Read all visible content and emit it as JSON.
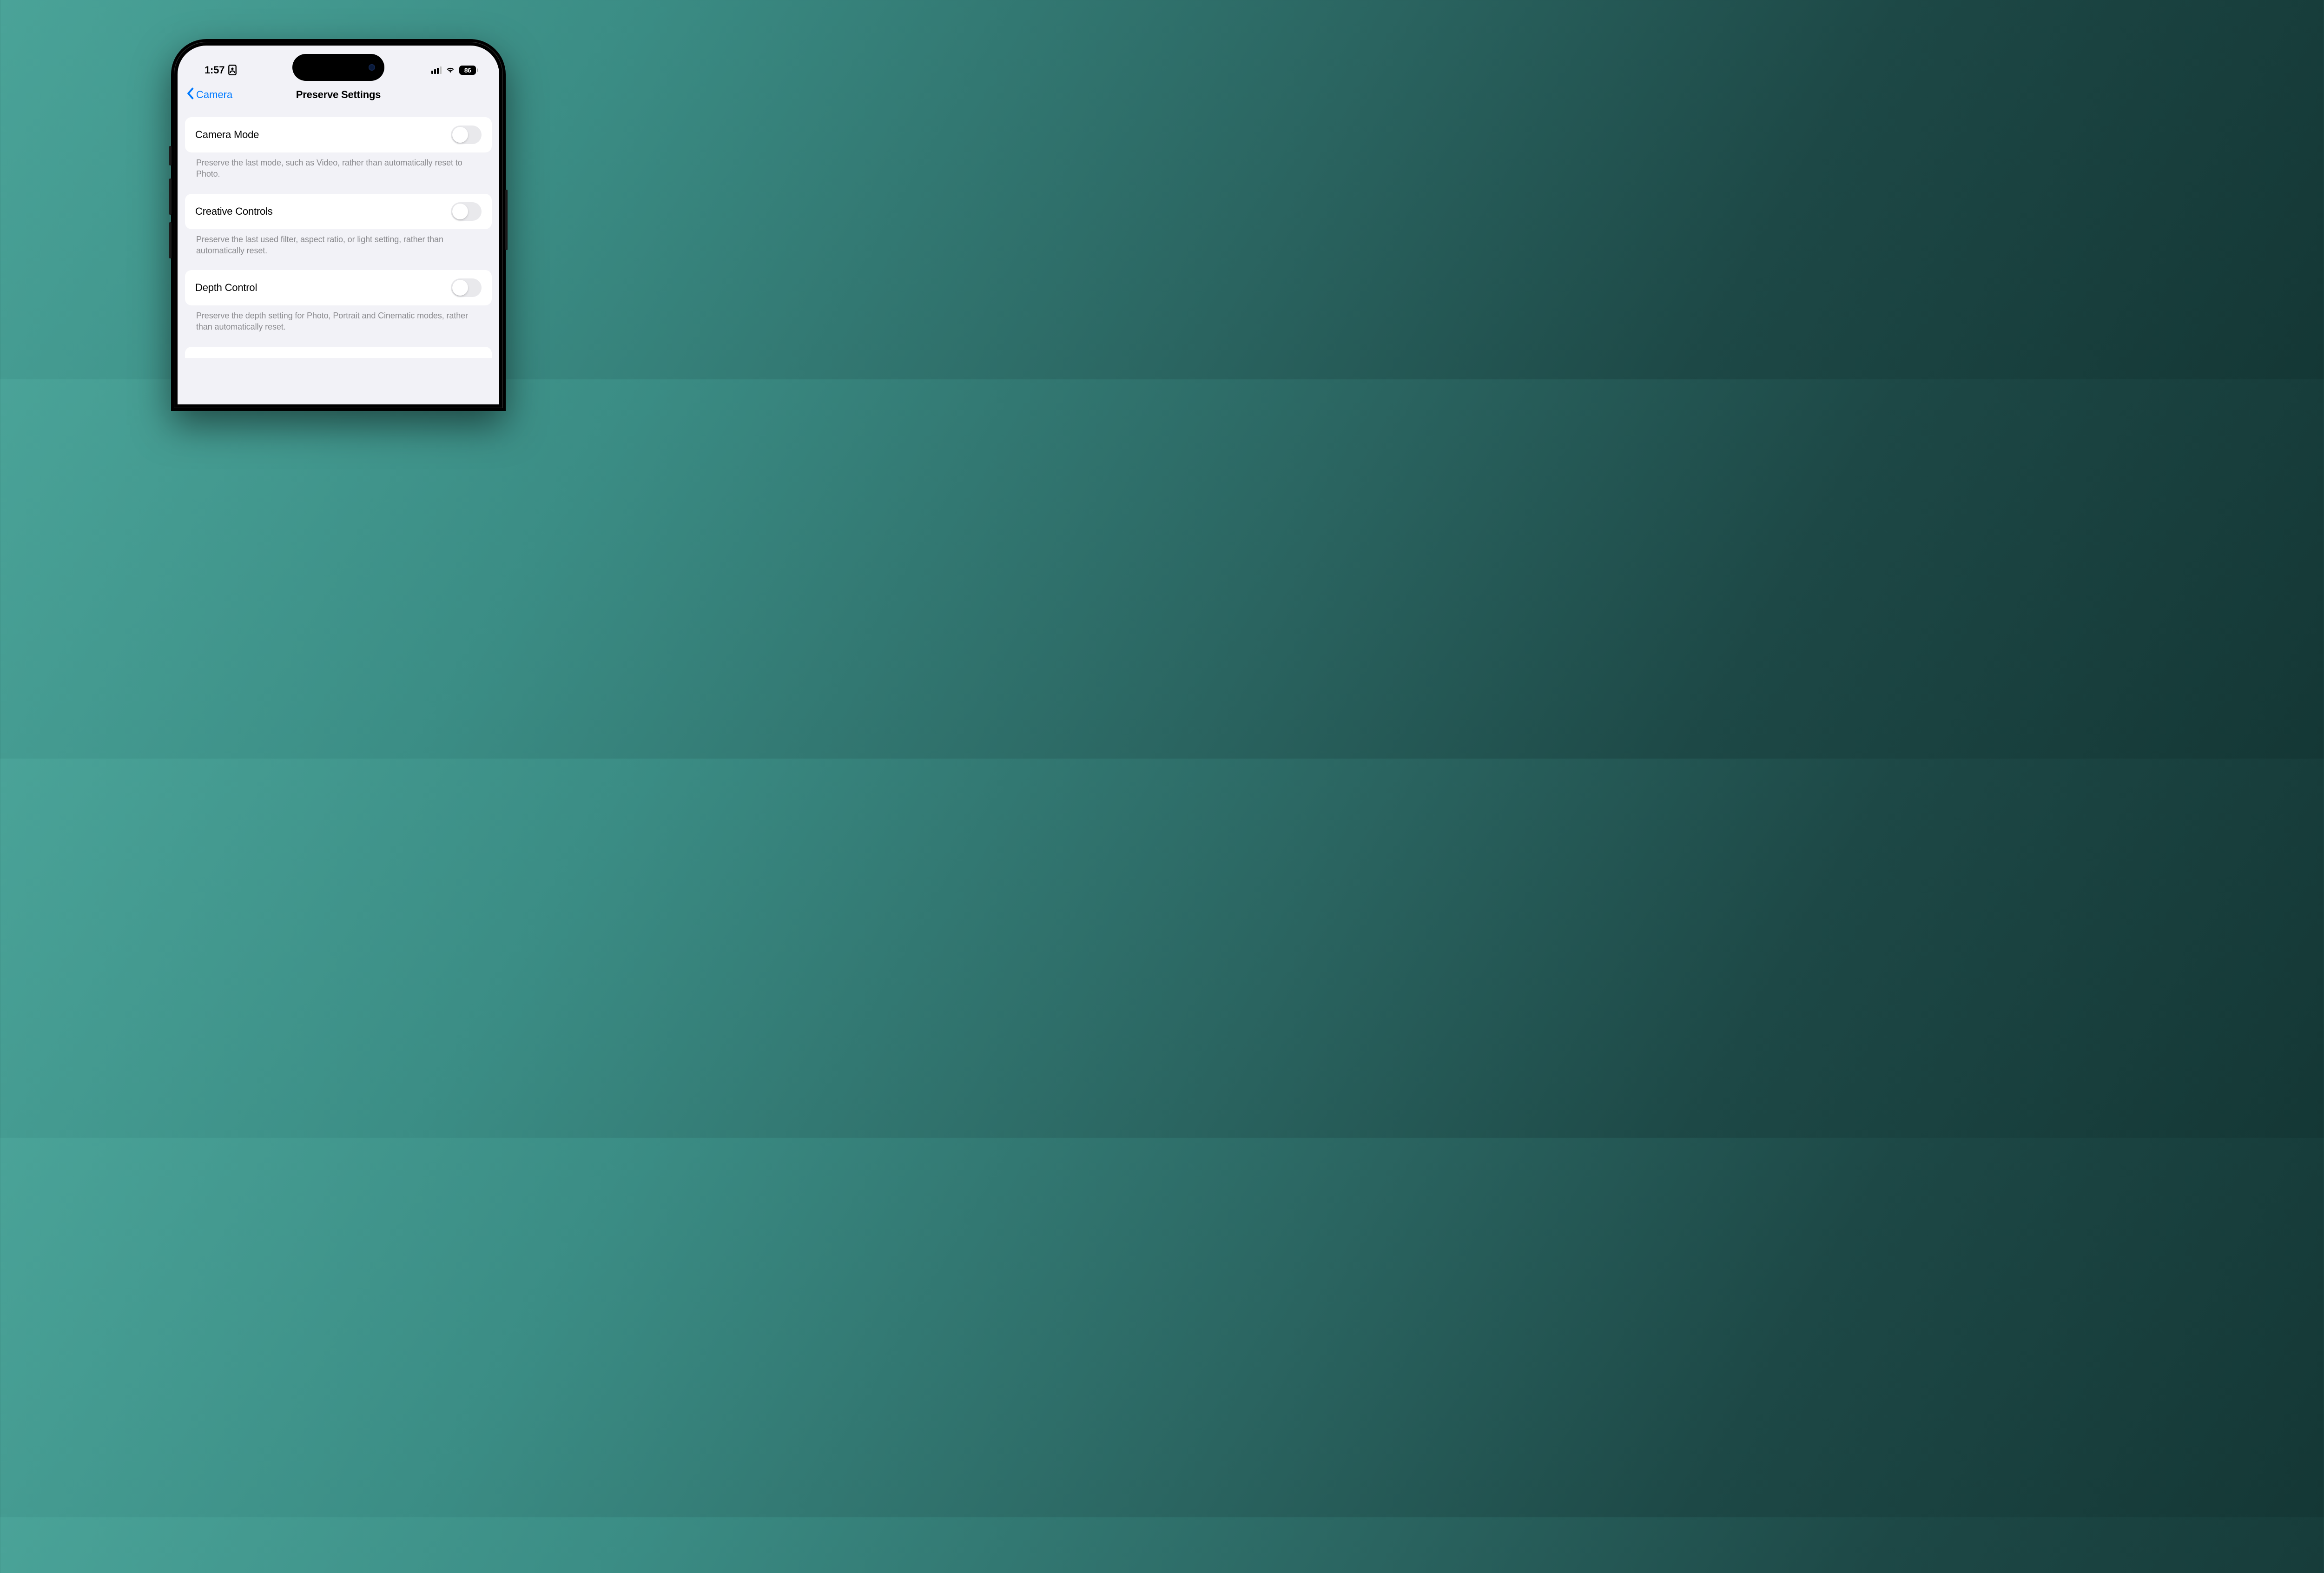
{
  "status": {
    "time": "1:57",
    "battery_percent": "86"
  },
  "nav": {
    "back_label": "Camera",
    "title": "Preserve Settings"
  },
  "settings": [
    {
      "label": "Camera Mode",
      "enabled": false,
      "description": "Preserve the last mode, such as Video, rather than automatically reset to Photo."
    },
    {
      "label": "Creative Controls",
      "enabled": false,
      "description": "Preserve the last used filter, aspect ratio, or light setting, rather than automatically reset."
    },
    {
      "label": "Depth Control",
      "enabled": false,
      "description": "Preserve the depth setting for Photo, Portrait and Cinematic modes, rather than automatically reset."
    }
  ]
}
